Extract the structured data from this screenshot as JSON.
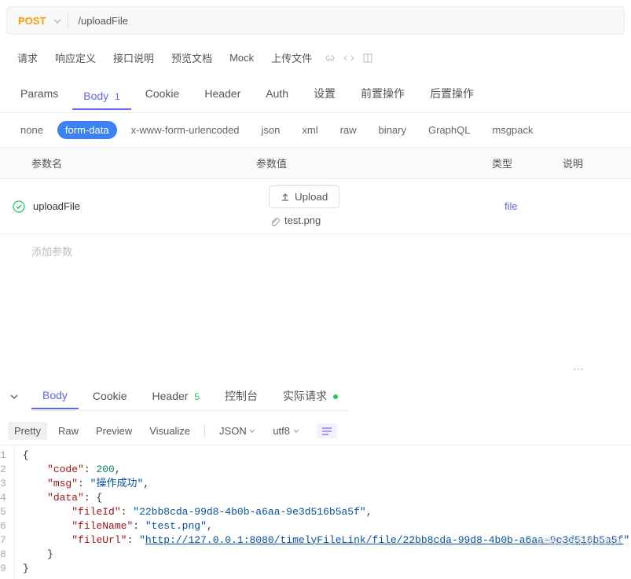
{
  "request": {
    "method": "POST",
    "url": "/uploadFile"
  },
  "top_tabs": {
    "items": [
      "请求",
      "响应定义",
      "接口说明",
      "预览文档",
      "Mock",
      "上传文件"
    ]
  },
  "request_tabs": {
    "params": "Params",
    "body": "Body",
    "body_count": "1",
    "cookie": "Cookie",
    "header": "Header",
    "auth": "Auth",
    "settings": "设置",
    "pre": "前置操作",
    "post": "后置操作"
  },
  "body_types": [
    "none",
    "form-data",
    "x-www-form-urlencoded",
    "json",
    "xml",
    "raw",
    "binary",
    "GraphQL",
    "msgpack"
  ],
  "table": {
    "headers": {
      "name": "参数名",
      "value": "参数值",
      "type": "类型",
      "desc": "说明"
    },
    "row": {
      "name": "uploadFile",
      "upload_label": "Upload",
      "file": "test.png",
      "type": "file"
    },
    "add": "添加参数"
  },
  "response_tabs": {
    "body": "Body",
    "cookie": "Cookie",
    "header": "Header",
    "header_count": "5",
    "console": "控制台",
    "actual": "实际请求"
  },
  "format_bar": {
    "pretty": "Pretty",
    "raw": "Raw",
    "preview": "Preview",
    "visualize": "Visualize",
    "json": "JSON",
    "encoding": "utf8"
  },
  "chart_data": {
    "type": "table",
    "response_json": {
      "code": 200,
      "msg": "操作成功",
      "data": {
        "fileId": "22bb8cda-99d8-4b0b-a6aa-9e3d516b5a5f",
        "fileName": "test.png",
        "fileUrl": "http://127.0.0.1:8080/timelyFileLink/file/22bb8cda-99d8-4b0b-a6aa-9e3d516b5a5f"
      }
    }
  },
  "code": {
    "l1": "{",
    "l2_k": "\"code\"",
    "l2_v": "200",
    "l3_k": "\"msg\"",
    "l3_v": "\"操作成功\"",
    "l4_k": "\"data\"",
    "l5_k": "\"fileId\"",
    "l5_v": "\"22bb8cda-99d8-4b0b-a6aa-9e3d516b5a5f\"",
    "l6_k": "\"fileName\"",
    "l6_v": "\"test.png\"",
    "l7_k": "\"fileUrl\"",
    "l7_v": "http://127.0.0.1:8080/timelyFileLink/file/22bb8cda-99d8-4b0b-a6aa-9e3d516b5a5f",
    "l8": "    }",
    "l9": "}"
  },
  "watermark": "@稀土掘金技术社区"
}
